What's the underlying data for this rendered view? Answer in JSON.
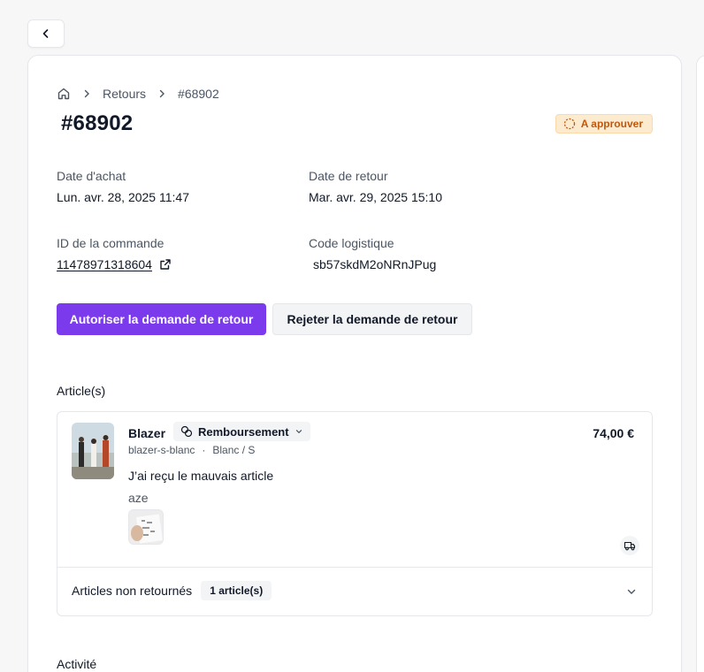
{
  "breadcrumb": {
    "home_icon": "home-icon",
    "section": "Retours",
    "current": "#68902"
  },
  "header": {
    "title": "#68902",
    "status": "A approuver",
    "status_color": "#c2570c"
  },
  "details": {
    "purchase_label": "Date d'achat",
    "purchase_value": "Lun. avr. 28, 2025 11:47",
    "return_label": "Date de retour",
    "return_value": "Mar. avr. 29, 2025 15:10",
    "order_label": "ID de la commande",
    "order_value": "11478971318604",
    "logistic_label": "Code logistique",
    "logistic_value": "sb57skdM2oNRnJPug"
  },
  "actions": {
    "approve_label": "Autoriser la demande de retour",
    "reject_label": "Rejeter la demande de retour",
    "accent": "#7c3aed"
  },
  "articles": {
    "section_title": "Article(s)",
    "item": {
      "name": "Blazer",
      "resolution": "Remboursement",
      "sku": "blazer-s-blanc",
      "separator": "·",
      "variant": "Blanc / S",
      "price": "74,00 €",
      "reason": "J’ai reçu le mauvais article",
      "comment": "aze"
    },
    "not_returned_label": "Articles non retournés",
    "not_returned_count": "1 article(s)"
  },
  "activity": {
    "section_title": "Activité"
  }
}
